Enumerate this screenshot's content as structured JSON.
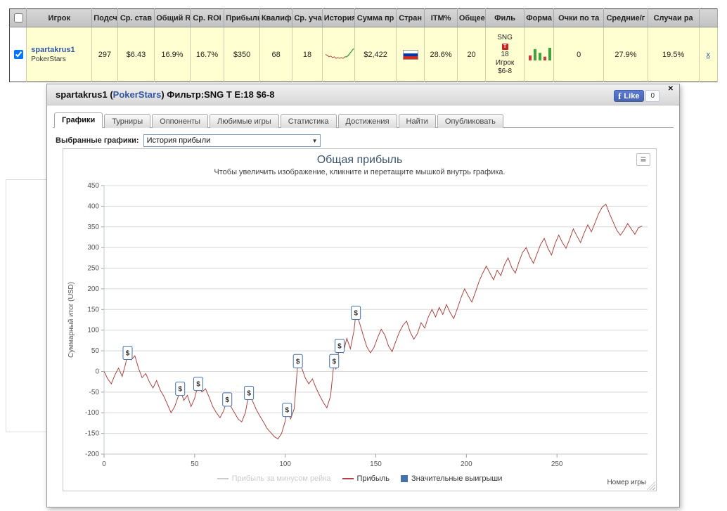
{
  "icons": {
    "close": "✕",
    "hamburger": "≡",
    "select_arrow": "▼"
  },
  "colors": {
    "accent_blue": "#4572A7",
    "line_red": "#AA4643",
    "link_blue": "#3457a0",
    "row_bg": "#ffffd2",
    "title_blue": "#3E576F",
    "green": "#3fa33f",
    "red": "#cc3b3b",
    "flag_stripes": [
      "#ffffff",
      "#0039a6",
      "#d52b1e"
    ]
  },
  "table": {
    "headers": [
      "Игрок",
      "Подсч",
      "Ср. став",
      "Общий ROI",
      "Ср. ROI",
      "Прибыль",
      "Квалиф",
      "Ср. уча",
      "История г",
      "Сумма пр",
      "Стран",
      "ITM%",
      "Общее",
      "Филь",
      "Форма",
      "Очки по та",
      "Средние/г",
      "Случаи ра"
    ],
    "row": {
      "player": "spartakrus1",
      "site": "PokerStars",
      "counted": "297",
      "avg_stake": "$6.43",
      "total_roi": "16.9%",
      "avg_roi": "16.7%",
      "profit": "$350",
      "qualif": "68",
      "avg_entrants": "18",
      "total_prize": "$2,422",
      "country": "russia",
      "itm": "28.6%",
      "total_count": "20",
      "filter": {
        "l1": "SNG",
        "badge": "T",
        "l2": "18",
        "l3": "Игрок",
        "l4": "$6-8"
      },
      "leaderboard_points": "0",
      "averages": "27.9%",
      "cases": "19.5%",
      "remove": "x",
      "history_spark": {
        "red": [
          0,
          -1,
          -3,
          -2,
          -4,
          -3,
          -5,
          -4,
          -5,
          -4,
          -5,
          -3
        ],
        "green": [
          -3,
          -1,
          2,
          5,
          8
        ]
      },
      "form_bars": [
        {
          "h": 4,
          "c": "red"
        },
        {
          "h": 9,
          "c": "green"
        },
        {
          "h": 6,
          "c": "green"
        },
        {
          "h": 3,
          "c": "red"
        },
        {
          "h": 10,
          "c": "green"
        }
      ]
    }
  },
  "popup": {
    "title_prefix": "spartakrus1 (",
    "title_site": "PokerStars",
    "title_suffix": ") Фильтр:SNG Т Е:18 $6-8",
    "fb": {
      "f": "f",
      "label": "Like",
      "count": "0"
    },
    "tabs": [
      {
        "label": "Графики",
        "active": true
      },
      {
        "label": "Турниры",
        "active": false
      },
      {
        "label": "Оппоненты",
        "active": false
      },
      {
        "label": "Любимые игры",
        "active": false
      },
      {
        "label": "Статистика",
        "active": false
      },
      {
        "label": "Достижения",
        "active": false
      },
      {
        "label": "Найти",
        "active": false
      },
      {
        "label": "Опубликовать",
        "active": false
      }
    ],
    "select_label": "Выбранные графики:",
    "select_value": "История прибыли"
  },
  "chart_data": {
    "type": "line",
    "title": "Общая прибыль",
    "subtitle": "Чтобы увеличить изображение, кликните и перетащите мышкой внутрь графика.",
    "ylabel": "Суммарный итог (USD)",
    "xlabel": "Номер игры",
    "ylim": [
      -200,
      450
    ],
    "xlim": [
      0,
      300
    ],
    "ytick_step": 50,
    "xticks": [
      0,
      50,
      100,
      150,
      200,
      250
    ],
    "grid": true,
    "legend_position": "bottom",
    "legend": [
      {
        "label": "Прибыль за минусом рейка",
        "color": "#cccccc",
        "type": "line",
        "disabled": true
      },
      {
        "label": "Прибыль",
        "color": "#AA4643",
        "type": "line",
        "disabled": false
      },
      {
        "label": "Значительные выигрыши",
        "color": "#4572A7",
        "type": "square",
        "disabled": false
      }
    ],
    "series": [
      {
        "name": "Прибыль",
        "color": "#AA4643",
        "points": [
          [
            0,
            0
          ],
          [
            2,
            -18
          ],
          [
            4,
            -30
          ],
          [
            6,
            -8
          ],
          [
            8,
            8
          ],
          [
            10,
            -12
          ],
          [
            12,
            20
          ],
          [
            13,
            45
          ],
          [
            15,
            28
          ],
          [
            17,
            38
          ],
          [
            19,
            8
          ],
          [
            21,
            -15
          ],
          [
            23,
            -5
          ],
          [
            25,
            -25
          ],
          [
            27,
            -40
          ],
          [
            29,
            -22
          ],
          [
            31,
            -45
          ],
          [
            33,
            -60
          ],
          [
            35,
            -80
          ],
          [
            37,
            -100
          ],
          [
            39,
            -85
          ],
          [
            41,
            -60
          ],
          [
            42,
            -42
          ],
          [
            44,
            -70
          ],
          [
            46,
            -58
          ],
          [
            48,
            -85
          ],
          [
            50,
            -65
          ],
          [
            52,
            -30
          ],
          [
            54,
            -50
          ],
          [
            56,
            -42
          ],
          [
            58,
            -62
          ],
          [
            60,
            -85
          ],
          [
            62,
            -100
          ],
          [
            64,
            -112
          ],
          [
            66,
            -95
          ],
          [
            68,
            -68
          ],
          [
            70,
            -85
          ],
          [
            72,
            -100
          ],
          [
            74,
            -115
          ],
          [
            76,
            -122
          ],
          [
            78,
            -100
          ],
          [
            80,
            -52
          ],
          [
            82,
            -72
          ],
          [
            84,
            -92
          ],
          [
            86,
            -108
          ],
          [
            88,
            -122
          ],
          [
            90,
            -138
          ],
          [
            92,
            -148
          ],
          [
            94,
            -158
          ],
          [
            96,
            -163
          ],
          [
            98,
            -150
          ],
          [
            100,
            -120
          ],
          [
            101,
            -93
          ],
          [
            103,
            -115
          ],
          [
            105,
            -90
          ],
          [
            107,
            25
          ],
          [
            109,
            10
          ],
          [
            111,
            -15
          ],
          [
            113,
            -30
          ],
          [
            115,
            -18
          ],
          [
            117,
            -40
          ],
          [
            119,
            -58
          ],
          [
            121,
            -75
          ],
          [
            123,
            -88
          ],
          [
            125,
            -60
          ],
          [
            127,
            25
          ],
          [
            128,
            5
          ],
          [
            130,
            62
          ],
          [
            132,
            45
          ],
          [
            134,
            80
          ],
          [
            136,
            55
          ],
          [
            138,
            100
          ],
          [
            139,
            142
          ],
          [
            141,
            118
          ],
          [
            143,
            88
          ],
          [
            145,
            60
          ],
          [
            147,
            45
          ],
          [
            149,
            58
          ],
          [
            151,
            82
          ],
          [
            153,
            102
          ],
          [
            155,
            88
          ],
          [
            157,
            62
          ],
          [
            159,
            48
          ],
          [
            161,
            72
          ],
          [
            163,
            95
          ],
          [
            165,
            112
          ],
          [
            167,
            122
          ],
          [
            169,
            95
          ],
          [
            171,
            78
          ],
          [
            173,
            92
          ],
          [
            175,
            118
          ],
          [
            177,
            105
          ],
          [
            179,
            132
          ],
          [
            181,
            150
          ],
          [
            183,
            132
          ],
          [
            185,
            155
          ],
          [
            187,
            138
          ],
          [
            189,
            162
          ],
          [
            191,
            143
          ],
          [
            193,
            128
          ],
          [
            195,
            152
          ],
          [
            197,
            178
          ],
          [
            199,
            200
          ],
          [
            201,
            183
          ],
          [
            203,
            168
          ],
          [
            205,
            192
          ],
          [
            207,
            218
          ],
          [
            209,
            238
          ],
          [
            211,
            255
          ],
          [
            213,
            238
          ],
          [
            215,
            222
          ],
          [
            217,
            245
          ],
          [
            219,
            232
          ],
          [
            221,
            258
          ],
          [
            223,
            275
          ],
          [
            225,
            252
          ],
          [
            227,
            238
          ],
          [
            229,
            265
          ],
          [
            231,
            288
          ],
          [
            233,
            300
          ],
          [
            235,
            278
          ],
          [
            237,
            262
          ],
          [
            239,
            285
          ],
          [
            241,
            308
          ],
          [
            243,
            322
          ],
          [
            245,
            298
          ],
          [
            247,
            282
          ],
          [
            249,
            310
          ],
          [
            251,
            330
          ],
          [
            253,
            312
          ],
          [
            255,
            298
          ],
          [
            257,
            320
          ],
          [
            259,
            345
          ],
          [
            261,
            328
          ],
          [
            263,
            312
          ],
          [
            265,
            335
          ],
          [
            267,
            355
          ],
          [
            269,
            338
          ],
          [
            271,
            360
          ],
          [
            273,
            382
          ],
          [
            275,
            398
          ],
          [
            277,
            405
          ],
          [
            279,
            382
          ],
          [
            281,
            362
          ],
          [
            283,
            342
          ],
          [
            285,
            330
          ],
          [
            287,
            342
          ],
          [
            289,
            358
          ],
          [
            291,
            345
          ],
          [
            293,
            332
          ],
          [
            295,
            348
          ],
          [
            297,
            352
          ]
        ]
      }
    ],
    "markers": {
      "name": "Значительные выигрыши",
      "symbol": "$",
      "color": "#4572A7",
      "points": [
        [
          13,
          45
        ],
        [
          42,
          -42
        ],
        [
          52,
          -30
        ],
        [
          68,
          -68
        ],
        [
          80,
          -52
        ],
        [
          101,
          -93
        ],
        [
          107,
          25
        ],
        [
          127,
          25
        ],
        [
          130,
          62
        ],
        [
          139,
          142
        ]
      ]
    }
  }
}
